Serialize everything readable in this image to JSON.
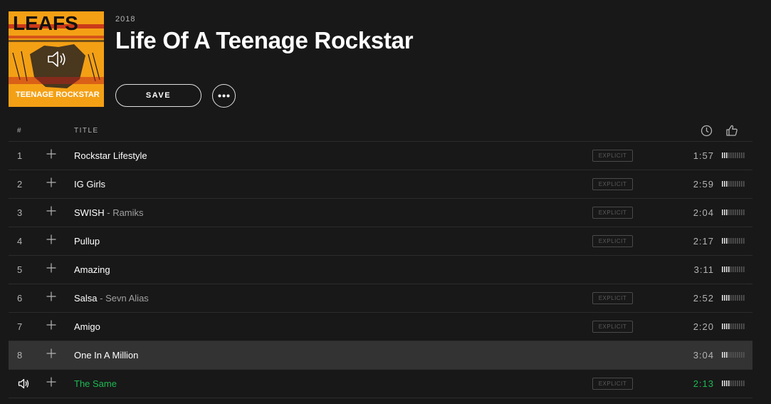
{
  "album": {
    "cover_text_top": "LEAFS",
    "cover_text_bottom": "TEENAGE ROCKSTAR",
    "year": "2018",
    "title": "Life Of A Teenage Rockstar",
    "save_label": "SAVE",
    "more_icon": "ellipsis-icon",
    "cover_speaker_icon": "volume-icon"
  },
  "table": {
    "header": {
      "num": "#",
      "title": "TITLE",
      "duration_icon": "clock-icon",
      "popularity_icon": "thumbs-up-icon"
    },
    "explicit_label": "EXPLICIT",
    "tracks": [
      {
        "num": "1",
        "title": "Rockstar Lifestyle",
        "artist_sep": "",
        "artist": "",
        "explicit": true,
        "duration": "1:57",
        "popularity": 0.3
      },
      {
        "num": "2",
        "title": "IG Girls",
        "artist_sep": "",
        "artist": "",
        "explicit": true,
        "duration": "2:59",
        "popularity": 0.3
      },
      {
        "num": "3",
        "title": "SWISH",
        "artist_sep": " - ",
        "artist": "Ramiks",
        "explicit": true,
        "duration": "2:04",
        "popularity": 0.3
      },
      {
        "num": "4",
        "title": "Pullup",
        "artist_sep": "",
        "artist": "",
        "explicit": true,
        "duration": "2:17",
        "popularity": 0.3
      },
      {
        "num": "5",
        "title": "Amazing",
        "artist_sep": "",
        "artist": "",
        "explicit": false,
        "duration": "3:11",
        "popularity": 0.4
      },
      {
        "num": "6",
        "title": "Salsa",
        "artist_sep": " - ",
        "artist": "Sevn Alias",
        "explicit": true,
        "duration": "2:52",
        "popularity": 0.4
      },
      {
        "num": "7",
        "title": "Amigo",
        "artist_sep": "",
        "artist": "",
        "explicit": true,
        "duration": "2:20",
        "popularity": 0.4
      },
      {
        "num": "8",
        "title": "One In A Million",
        "artist_sep": "",
        "artist": "",
        "explicit": false,
        "duration": "3:04",
        "popularity": 0.3,
        "hover": true
      },
      {
        "num": "",
        "title": "The Same",
        "artist_sep": "",
        "artist": "",
        "explicit": true,
        "duration": "2:13",
        "popularity": 0.4,
        "playing": true
      }
    ]
  },
  "colors": {
    "background": "#181818",
    "accent_green": "#1db954",
    "hover_row": "#333333",
    "cover_orange": "#f4a015"
  }
}
